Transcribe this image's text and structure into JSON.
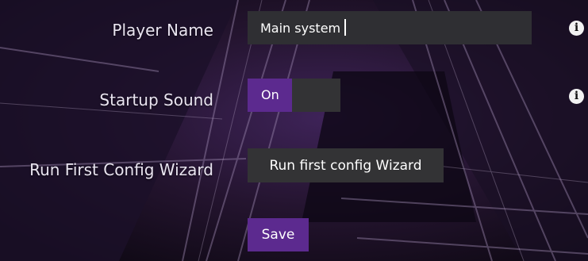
{
  "settings": {
    "player_name": {
      "label": "Player Name",
      "value": "Main system"
    },
    "startup_sound": {
      "label": "Startup Sound",
      "toggle_on_label": "On",
      "state": "on"
    },
    "first_config": {
      "label": "Run First Config Wizard",
      "button_label": "Run first config Wizard"
    },
    "save_label": "Save"
  },
  "icons": {
    "info": "info-icon"
  },
  "colors": {
    "accent": "#5c2a8f",
    "control_bg": "#333335",
    "text": "#e9e4f0"
  }
}
